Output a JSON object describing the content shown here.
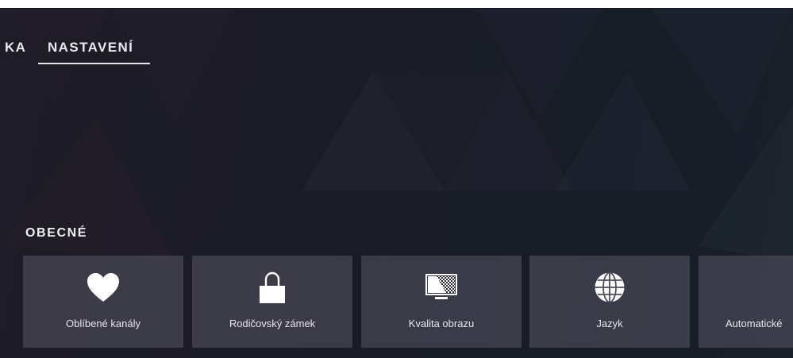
{
  "nav": {
    "prev_label": "KA",
    "active_label": "NASTAVENÍ"
  },
  "section": {
    "title": "OBECNÉ"
  },
  "tiles": [
    {
      "label": "Oblíbené kanály",
      "icon": "heart-icon"
    },
    {
      "label": "Rodičovský zámek",
      "icon": "padlock-icon"
    },
    {
      "label": "Kvalita obrazu",
      "icon": "tv-quality-icon"
    },
    {
      "label": "Jazyk",
      "icon": "globe-icon"
    },
    {
      "label": "Automatické",
      "icon": "clock-icon"
    }
  ],
  "colors": {
    "background": "#1b1c27",
    "tile": "#4f4d5b",
    "text": "#e6e6ea"
  }
}
